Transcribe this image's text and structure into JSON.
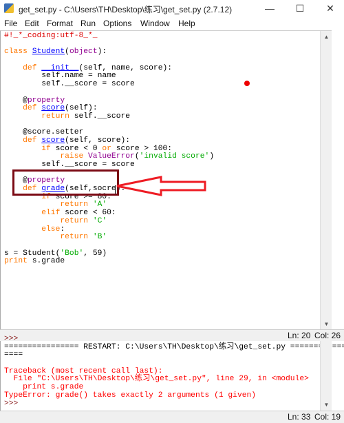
{
  "window": {
    "title": "get_set.py - C:\\Users\\TH\\Desktop\\练习\\get_set.py (2.7.12)",
    "minimize": "—",
    "maximize": "☐",
    "close": "✕"
  },
  "menu": [
    "File",
    "Edit",
    "Format",
    "Run",
    "Options",
    "Window",
    "Help"
  ],
  "colors": {
    "keyword": "#ff7700",
    "builtin": "#900090",
    "defname": "#0000ff",
    "string": "#00aa00",
    "comment": "#dd0000",
    "error": "#ff0000",
    "annotation": "#7b0a14",
    "arrow": "#ee1c24"
  },
  "editor": {
    "lines": [
      [
        [
          "#!_*_coding:utf-8_*_",
          "c"
        ]
      ],
      [],
      [
        [
          "class ",
          "k"
        ],
        [
          "Student",
          "d"
        ],
        [
          "(",
          ""
        ],
        [
          "object",
          "b"
        ],
        [
          "):",
          ""
        ]
      ],
      [],
      [
        [
          "    def ",
          "k"
        ],
        [
          "__init__",
          "d"
        ],
        [
          "(self, name, score):",
          ""
        ]
      ],
      [
        [
          "        self.name = name",
          ""
        ]
      ],
      [
        [
          "        self.__score = score",
          ""
        ]
      ],
      [],
      [
        [
          "    @",
          ""
        ],
        [
          "property",
          "b"
        ]
      ],
      [
        [
          "    def ",
          "k"
        ],
        [
          "score",
          "d"
        ],
        [
          "(self):",
          ""
        ]
      ],
      [
        [
          "        return ",
          "k"
        ],
        [
          "self.__score",
          ""
        ]
      ],
      [],
      [
        [
          "    @score.setter",
          ""
        ]
      ],
      [
        [
          "    def ",
          "k"
        ],
        [
          "score",
          "d"
        ],
        [
          "(self, score):",
          ""
        ]
      ],
      [
        [
          "        if ",
          "k"
        ],
        [
          "score < 0 ",
          ""
        ],
        [
          "or ",
          "k"
        ],
        [
          "score > 100:",
          ""
        ]
      ],
      [
        [
          "            raise ",
          "k"
        ],
        [
          "ValueError",
          "b"
        ],
        [
          "(",
          ""
        ],
        [
          "'invalid score'",
          "s"
        ],
        [
          ")",
          ""
        ]
      ],
      [
        [
          "        self.__score = score",
          ""
        ]
      ],
      [],
      [
        [
          "    @",
          ""
        ],
        [
          "property",
          "b"
        ]
      ],
      [
        [
          "    def ",
          "k"
        ],
        [
          "grade",
          "d"
        ],
        [
          "(self,socre):",
          ""
        ]
      ],
      [
        [
          "        if ",
          "k"
        ],
        [
          "score >= 80:",
          ""
        ]
      ],
      [
        [
          "            return ",
          "k"
        ],
        [
          "'A'",
          "s"
        ]
      ],
      [
        [
          "        elif ",
          "k"
        ],
        [
          "score < 60:",
          ""
        ]
      ],
      [
        [
          "            return ",
          "k"
        ],
        [
          "'C'",
          "s"
        ]
      ],
      [
        [
          "        else",
          "k"
        ],
        [
          ":",
          ""
        ]
      ],
      [
        [
          "            return ",
          "k"
        ],
        [
          "'B'",
          "s"
        ]
      ],
      [],
      [
        [
          "s = Student(",
          ""
        ],
        [
          "'Bob'",
          "s"
        ],
        [
          ", 59)",
          ""
        ]
      ],
      [
        [
          "print ",
          "k"
        ],
        [
          "s.grade",
          ""
        ]
      ]
    ]
  },
  "editor_status": {
    "ln": "Ln: 20",
    "col": "Col: 26"
  },
  "shell": {
    "lines": [
      [
        [
          ">>>",
          "p"
        ]
      ],
      [
        [
          "================ RESTART: C:\\Users\\TH\\Desktop\\练习\\get_set.py ============",
          ""
        ]
      ],
      [
        [
          "====",
          ""
        ]
      ],
      [],
      [
        [
          "Traceback (most recent call last):",
          "e"
        ]
      ],
      [
        [
          "  File \"C:\\Users\\TH\\Desktop\\练习\\get_set.py\", line 29, in <module>",
          "e"
        ]
      ],
      [
        [
          "    print s.grade",
          "e"
        ]
      ],
      [
        [
          "TypeError: grade() takes exactly 2 arguments (1 given)",
          "e"
        ]
      ],
      [
        [
          ">>>",
          "p"
        ]
      ]
    ]
  },
  "shell_status": {
    "ln": "Ln: 33",
    "col": "Col: 19"
  }
}
